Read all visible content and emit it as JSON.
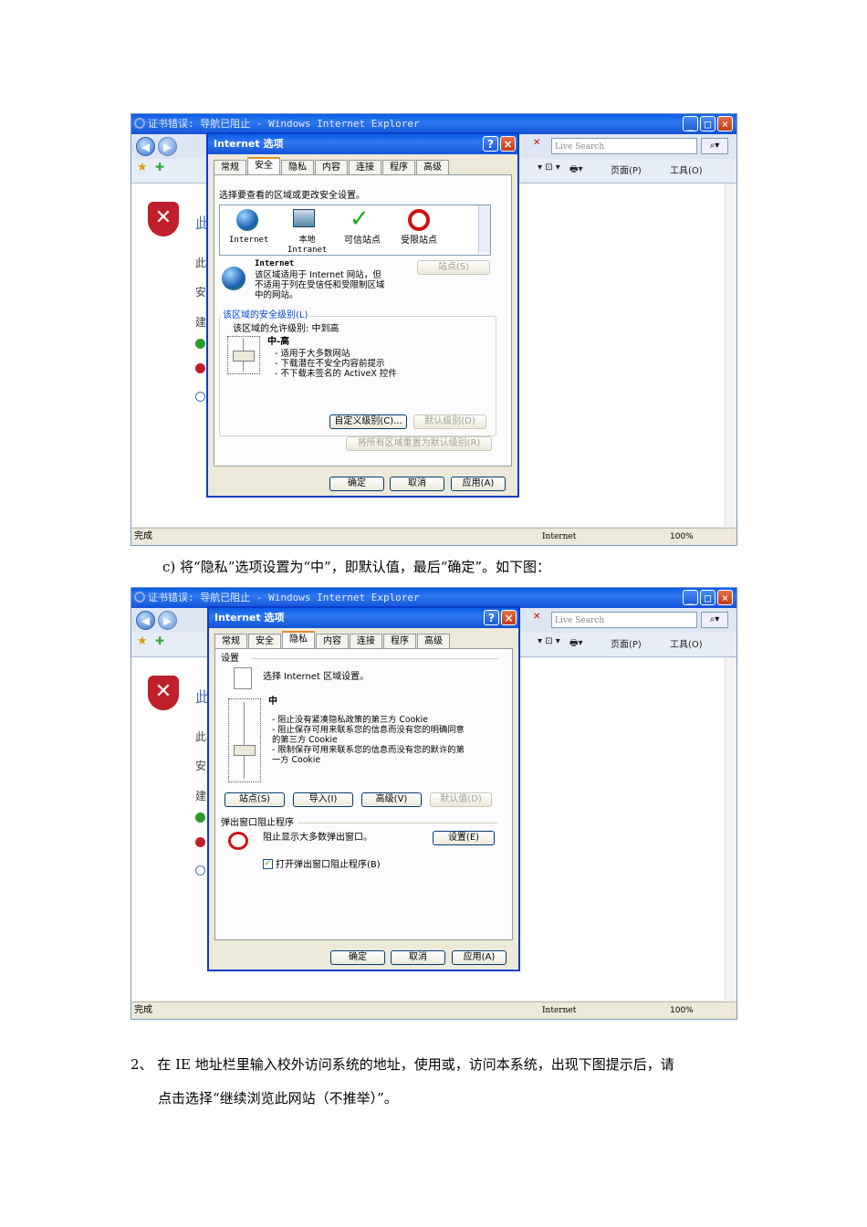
{
  "screenshot1": {
    "window_title": "证书错误: 导航已阻止 - Windows Internet Explorer",
    "search_placeholder": "Live Search",
    "toolbar_page": "页面(P)",
    "toolbar_tools": "工具(O)",
    "status_left": "完成",
    "status_zone": "Internet",
    "status_zoom": "100%",
    "page_partial": [
      "此",
      "此",
      "安",
      "建"
    ],
    "dialog": {
      "title": "Internet 选项",
      "tabs": [
        "常规",
        "安全",
        "隐私",
        "内容",
        "连接",
        "程序",
        "高级"
      ],
      "active_tab": "安全",
      "instruction": "选择要查看的区域或更改安全设置。",
      "zones": [
        "Internet",
        "本地\nIntranet",
        "可信站点",
        "受限站点"
      ],
      "zone_name": "Internet",
      "zone_desc": "该区域适用于 Internet 网站，但\n不适用于列在受信任和受限制区域\n中的网站。",
      "sites_button": "站点(S)",
      "security_level_group": "该区域的安全级别(L)",
      "allowed_levels": "该区域的允许级别: 中到高",
      "level_name": "中-高",
      "level_bullets": "- 适用于大多数网站\n- 下载潜在不安全内容前提示\n- 不下载未签名的 ActiveX 控件",
      "custom_level_button": "自定义级别(C)...",
      "default_level_button": "默认级别(D)",
      "reset_all_button": "将所有区域重置为默认级别(R)",
      "ok": "确定",
      "cancel": "取消",
      "apply": "应用(A)"
    }
  },
  "caption_c": "c)    将“隐私”选项设置为“中”，即默认值，最后“确定”。如下图：",
  "screenshot2": {
    "window_title": "证书错误: 导航已阻止 - Windows Internet Explorer",
    "search_placeholder": "Live Search",
    "toolbar_page": "页面(P)",
    "toolbar_tools": "工具(O)",
    "status_left": "完成",
    "status_zone": "Internet",
    "status_zoom": "100%",
    "page_partial": [
      "此",
      "此",
      "安",
      "建"
    ],
    "dialog": {
      "title": "Internet 选项",
      "tabs": [
        "常规",
        "安全",
        "隐私",
        "内容",
        "连接",
        "程序",
        "高级"
      ],
      "active_tab": "隐私",
      "settings_group": "设置",
      "settings_instruction": "选择 Internet 区域设置。",
      "level_name": "中",
      "level_bullets": "- 阻止没有紧凑隐私政策的第三方 Cookie\n- 阻止保存可用来联系您的信息而没有您的明确同意\n的第三方 Cookie\n- 限制保存可用来联系您的信息而没有您的默许的第\n一方 Cookie",
      "sites_button": "站点(S)",
      "import_button": "导入(I)",
      "advanced_button": "高级(V)",
      "default_button": "默认值(D)",
      "popup_group": "弹出窗口阻止程序",
      "popup_desc": "阻止显示大多数弹出窗口。",
      "popup_settings_button": "设置(E)",
      "popup_checkbox": "打开弹出窗口阻止程序(B)",
      "popup_checked": true,
      "ok": "确定",
      "cancel": "取消",
      "apply": "应用(A)"
    }
  },
  "step2_line1": "2、 在 IE 地址栏里输入校外访问系统的地址，使用或，访问本系统，出现下图提示后，请",
  "step2_line2": "点击选择“继续浏览此网站（不推举）”。"
}
